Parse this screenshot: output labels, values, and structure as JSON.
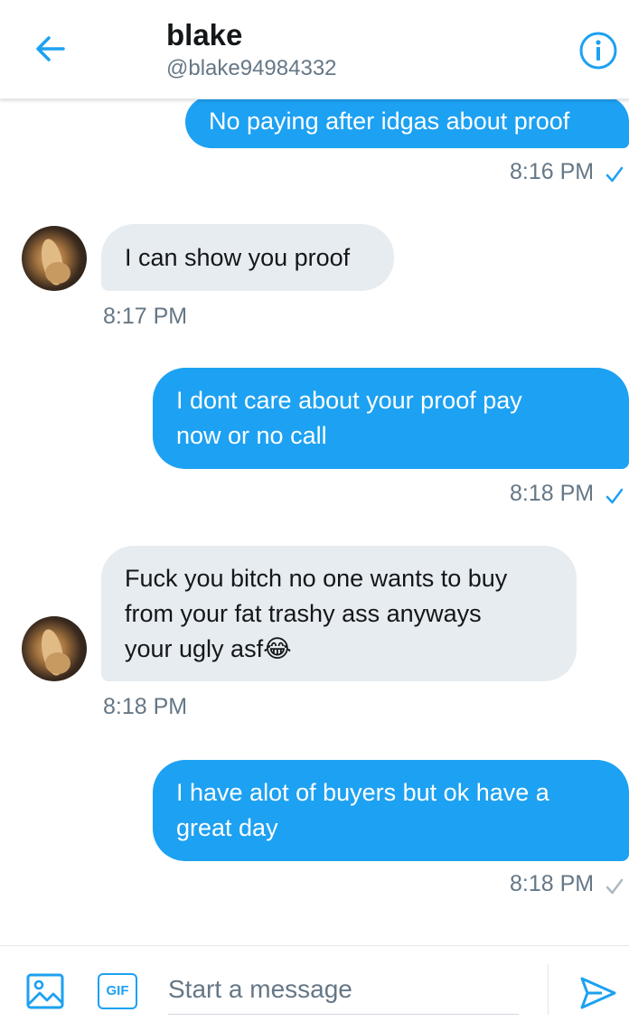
{
  "header": {
    "name": "blake",
    "handle": "@blake94984332",
    "back_icon": "arrow-left-icon",
    "info_icon": "info-circle-icon"
  },
  "messages": [
    {
      "direction": "sent",
      "lines": [
        "No paying after idgas about proof"
      ],
      "time": "8:16 PM",
      "status": "read"
    },
    {
      "direction": "received",
      "lines": [
        "I can show you proof"
      ],
      "time": "8:17 PM"
    },
    {
      "direction": "sent",
      "lines": [
        "I dont care about your proof pay",
        "now or no call"
      ],
      "time": "8:18 PM",
      "status": "read"
    },
    {
      "direction": "received",
      "lines": [
        "Fuck you bitch no one wants to buy",
        "from your fat trashy ass anyways",
        "your ugly asf😂"
      ],
      "time": "8:18 PM"
    },
    {
      "direction": "sent",
      "lines": [
        "I have alot of buyers but ok have a",
        "great day"
      ],
      "time": "8:18 PM",
      "status": "sent"
    }
  ],
  "composer": {
    "placeholder": "Start a message",
    "gif_label": "GIF",
    "image_icon": "image-icon",
    "send_icon": "send-icon"
  },
  "colors": {
    "accent": "#1da1f2",
    "received_bubble": "#e6ecf0",
    "secondary_text": "#657786",
    "unread_check": "#aab8c2"
  }
}
